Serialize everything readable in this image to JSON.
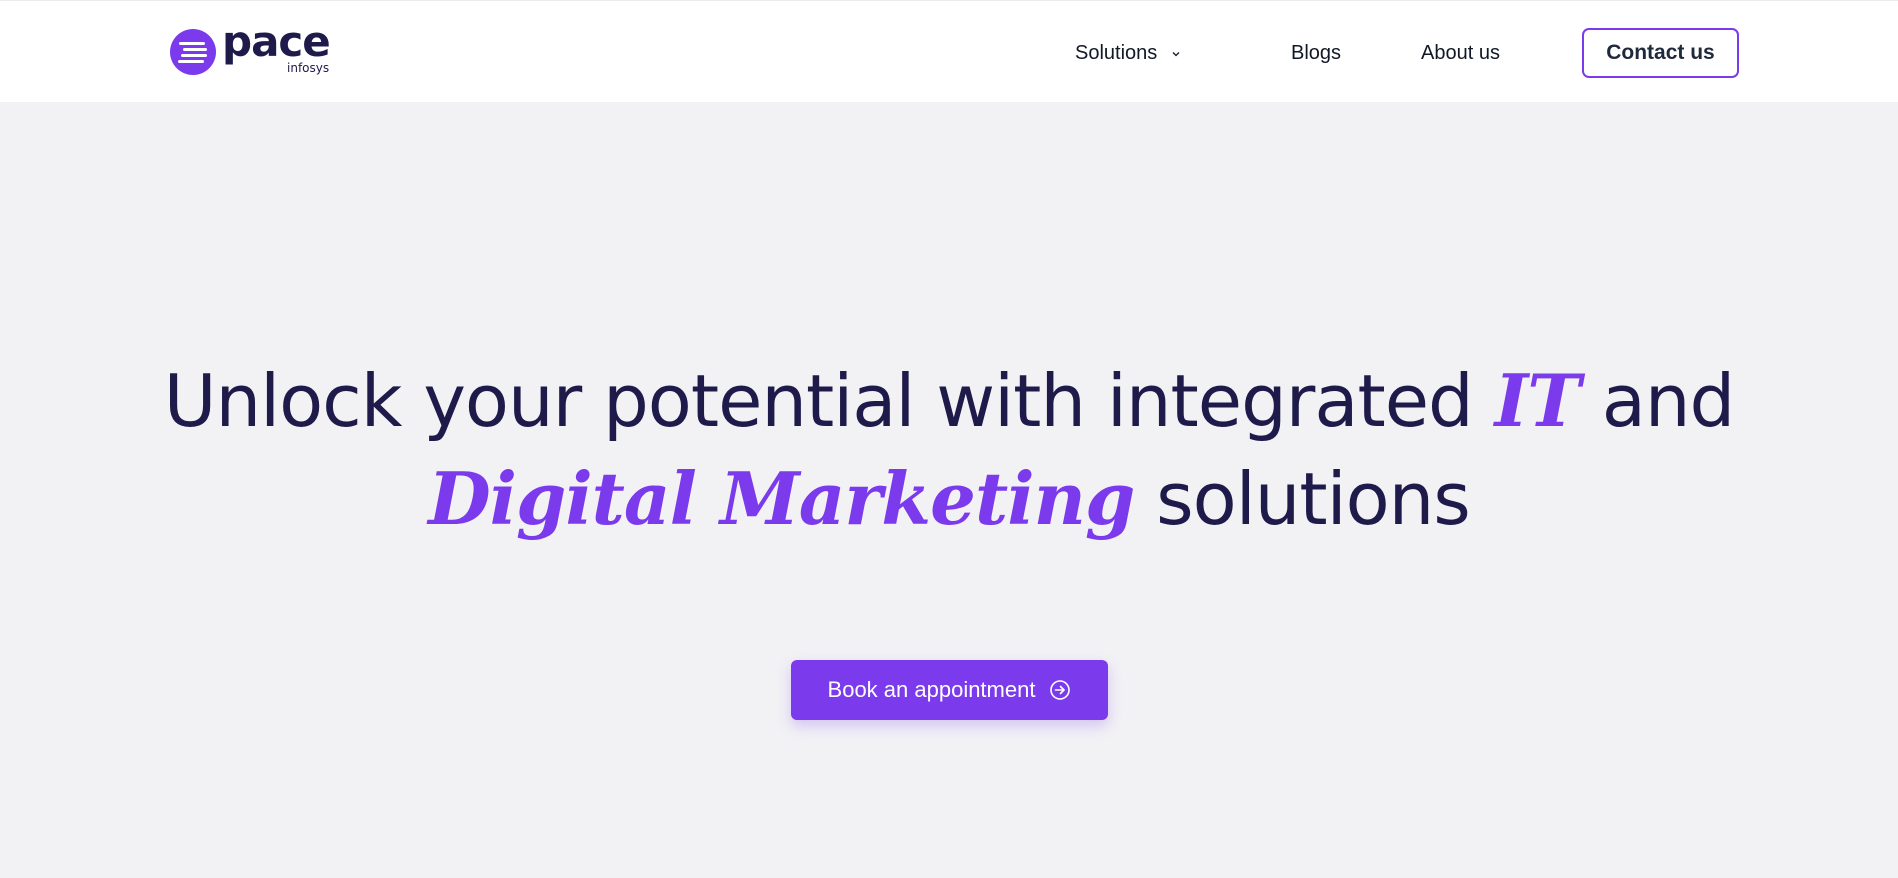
{
  "brand": {
    "name": "pace",
    "sub": "infosys",
    "accent_color": "#7c3aed",
    "text_color": "#1e1b4b"
  },
  "nav": {
    "solutions_label": "Solutions",
    "blogs_label": "Blogs",
    "about_label": "About us",
    "contact_label": "Contact us"
  },
  "hero": {
    "line1_part1": "Unlock your potential with integrated ",
    "line1_accent": "IT",
    "line1_part2": " and",
    "line2_accent": "Digital Marketing",
    "line2_part2": " solutions",
    "cta_label": "Book an appointment",
    "cta_icon": "arrow-right-circle-icon"
  }
}
